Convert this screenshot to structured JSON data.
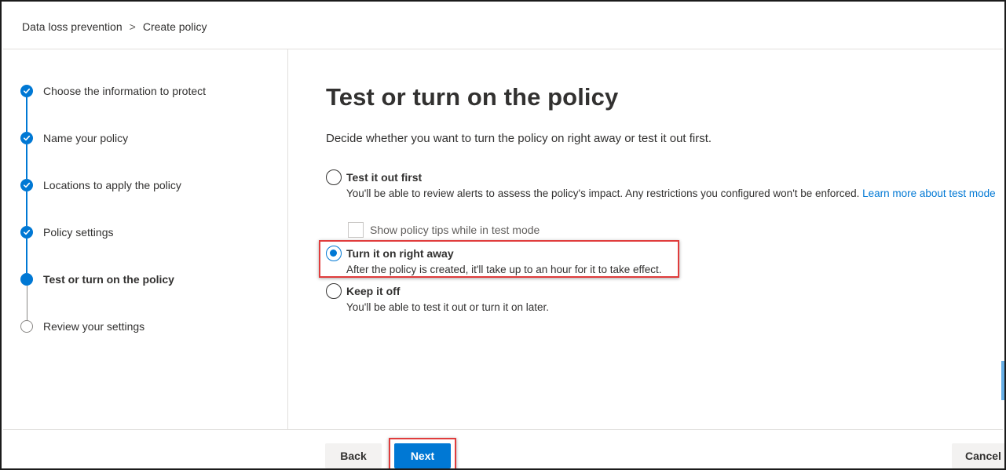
{
  "breadcrumb": {
    "items": [
      "Data loss prevention",
      "Create policy"
    ],
    "separator": ">"
  },
  "wizard": {
    "steps": [
      {
        "label": "Choose the information to protect",
        "state": "done"
      },
      {
        "label": "Name your policy",
        "state": "done"
      },
      {
        "label": "Locations to apply the policy",
        "state": "done"
      },
      {
        "label": "Policy settings",
        "state": "done"
      },
      {
        "label": "Test or turn on the policy",
        "state": "current"
      },
      {
        "label": "Review your settings",
        "state": "todo"
      }
    ]
  },
  "main": {
    "title": "Test or turn on the policy",
    "description": "Decide whether you want to turn the policy on right away or test it out first.",
    "options": [
      {
        "title": "Test it out first",
        "description": "You'll be able to review alerts to assess the policy's impact. Any restrictions you configured won't be enforced.",
        "link": "Learn more about test mode",
        "checked": false
      },
      {
        "title": "Turn it on right away",
        "description": "After the policy is created, it'll take up to an hour for it to take effect.",
        "checked": true
      },
      {
        "title": "Keep it off",
        "description": "You'll be able to test it out or turn it on later.",
        "checked": false
      }
    ],
    "test_mode_checkbox": {
      "label": "Show policy tips while in test mode",
      "checked": false,
      "disabled": true
    }
  },
  "footer": {
    "back_label": "Back",
    "next_label": "Next",
    "cancel_label": "Cancel"
  },
  "colors": {
    "accent": "#0078d4",
    "highlight": "#e03c3c"
  },
  "icons": {
    "step_done": "checkmark-circle-icon",
    "step_current": "filled-circle-icon",
    "step_todo": "empty-circle-icon",
    "breadcrumb_separator": "chevron-right-icon"
  }
}
